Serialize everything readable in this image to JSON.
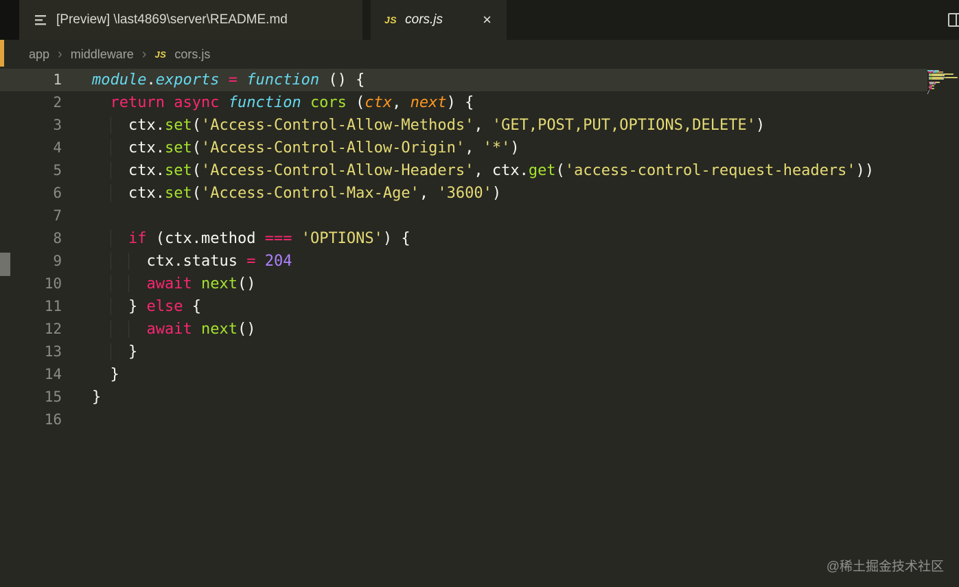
{
  "tab_bar": {
    "tabs": [
      {
        "label": "[Preview] \\last4869\\server\\README.md",
        "icon": "preview-icon",
        "active": false
      },
      {
        "label": "cors.js",
        "icon": "js-icon",
        "active": true,
        "close": "×"
      }
    ]
  },
  "icons": {
    "js_badge": "JS"
  },
  "breadcrumb": {
    "separator": "›",
    "items": [
      {
        "label": "app"
      },
      {
        "label": "middleware"
      },
      {
        "label": "cors.js",
        "icon": "js-icon"
      }
    ]
  },
  "editor": {
    "language": "javascript",
    "line_count": 16,
    "lines": [
      {
        "n": 1,
        "current": true,
        "tokens": [
          [
            "module",
            "t"
          ],
          [
            ".",
            "p"
          ],
          [
            "exports",
            "t"
          ],
          [
            " ",
            "p"
          ],
          [
            "=",
            "k"
          ],
          [
            " ",
            "p"
          ],
          [
            "function",
            "t"
          ],
          [
            " () {",
            "p"
          ]
        ]
      },
      {
        "n": 2,
        "tokens": [
          [
            "  ",
            "w"
          ],
          [
            "return",
            "k"
          ],
          [
            " ",
            "p"
          ],
          [
            "async",
            "k"
          ],
          [
            " ",
            "p"
          ],
          [
            "function",
            "t"
          ],
          [
            " ",
            "p"
          ],
          [
            "cors",
            "f"
          ],
          [
            " (",
            "p"
          ],
          [
            "ctx",
            "a"
          ],
          [
            ", ",
            "p"
          ],
          [
            "next",
            "a"
          ],
          [
            ") {",
            "p"
          ]
        ]
      },
      {
        "n": 3,
        "tokens": [
          [
            "    ",
            "w"
          ],
          [
            "ctx.",
            "p"
          ],
          [
            "set",
            "f"
          ],
          [
            "(",
            "p"
          ],
          [
            "'Access-Control-Allow-Methods'",
            "s"
          ],
          [
            ", ",
            "p"
          ],
          [
            "'GET,POST,PUT,OPTIONS,DELETE'",
            "s"
          ],
          [
            ")",
            "p"
          ]
        ]
      },
      {
        "n": 4,
        "tokens": [
          [
            "    ",
            "w"
          ],
          [
            "ctx.",
            "p"
          ],
          [
            "set",
            "f"
          ],
          [
            "(",
            "p"
          ],
          [
            "'Access-Control-Allow-Origin'",
            "s"
          ],
          [
            ", ",
            "p"
          ],
          [
            "'*'",
            "s"
          ],
          [
            ")",
            "p"
          ]
        ]
      },
      {
        "n": 5,
        "tokens": [
          [
            "    ",
            "w"
          ],
          [
            "ctx.",
            "p"
          ],
          [
            "set",
            "f"
          ],
          [
            "(",
            "p"
          ],
          [
            "'Access-Control-Allow-Headers'",
            "s"
          ],
          [
            ", ",
            "p"
          ],
          [
            "ctx.",
            "p"
          ],
          [
            "get",
            "f"
          ],
          [
            "(",
            "p"
          ],
          [
            "'access-control-request-headers'",
            "s"
          ],
          [
            "))",
            "p"
          ]
        ]
      },
      {
        "n": 6,
        "tokens": [
          [
            "    ",
            "w"
          ],
          [
            "ctx.",
            "p"
          ],
          [
            "set",
            "f"
          ],
          [
            "(",
            "p"
          ],
          [
            "'Access-Control-Max-Age'",
            "s"
          ],
          [
            ", ",
            "p"
          ],
          [
            "'3600'",
            "s"
          ],
          [
            ")",
            "p"
          ]
        ]
      },
      {
        "n": 7,
        "tokens": []
      },
      {
        "n": 8,
        "tokens": [
          [
            "    ",
            "w"
          ],
          [
            "if",
            "k"
          ],
          [
            " (",
            "p"
          ],
          [
            "ctx.method ",
            "p"
          ],
          [
            "===",
            "k"
          ],
          [
            " ",
            "p"
          ],
          [
            "'OPTIONS'",
            "s"
          ],
          [
            ") {",
            "p"
          ]
        ]
      },
      {
        "n": 9,
        "tokens": [
          [
            "      ",
            "w"
          ],
          [
            "ctx.status ",
            "p"
          ],
          [
            "=",
            "k"
          ],
          [
            " ",
            "p"
          ],
          [
            "204",
            "n"
          ]
        ]
      },
      {
        "n": 10,
        "tokens": [
          [
            "      ",
            "w"
          ],
          [
            "await",
            "k"
          ],
          [
            " ",
            "p"
          ],
          [
            "next",
            "f"
          ],
          [
            "()",
            "p"
          ]
        ]
      },
      {
        "n": 11,
        "tokens": [
          [
            "    ",
            "w"
          ],
          [
            "} ",
            "p"
          ],
          [
            "else",
            "k"
          ],
          [
            " {",
            "p"
          ]
        ]
      },
      {
        "n": 12,
        "tokens": [
          [
            "      ",
            "w"
          ],
          [
            "await",
            "k"
          ],
          [
            " ",
            "p"
          ],
          [
            "next",
            "f"
          ],
          [
            "()",
            "p"
          ]
        ]
      },
      {
        "n": 13,
        "tokens": [
          [
            "    ",
            "w"
          ],
          [
            "}",
            "p"
          ]
        ]
      },
      {
        "n": 14,
        "tokens": [
          [
            "  ",
            "w"
          ],
          [
            "}",
            "p"
          ]
        ]
      },
      {
        "n": 15,
        "tokens": [
          [
            "}",
            "p"
          ]
        ]
      },
      {
        "n": 16,
        "tokens": []
      }
    ]
  },
  "colors": {
    "editor_bg": "#272822",
    "tab_bar_bg": "#1b1c17",
    "current_line_bg": "#373830",
    "line_number": "#8c8c86",
    "js_badge": "#e8d44d",
    "left_marker_orange": "#e2a33c",
    "left_marker_gray": "#72726c",
    "tokens": {
      "p": "#f8f8f2",
      "k": "#f92672",
      "f": "#a6e22e",
      "t": "#66d9ef",
      "s": "#e6db74",
      "a": "#fd971f",
      "n": "#ae81ff"
    },
    "italic_token_classes": [
      "t",
      "a"
    ],
    "minimap_plain": "#b5b5ab"
  },
  "watermark": {
    "text": "@稀土掘金技术社区"
  }
}
